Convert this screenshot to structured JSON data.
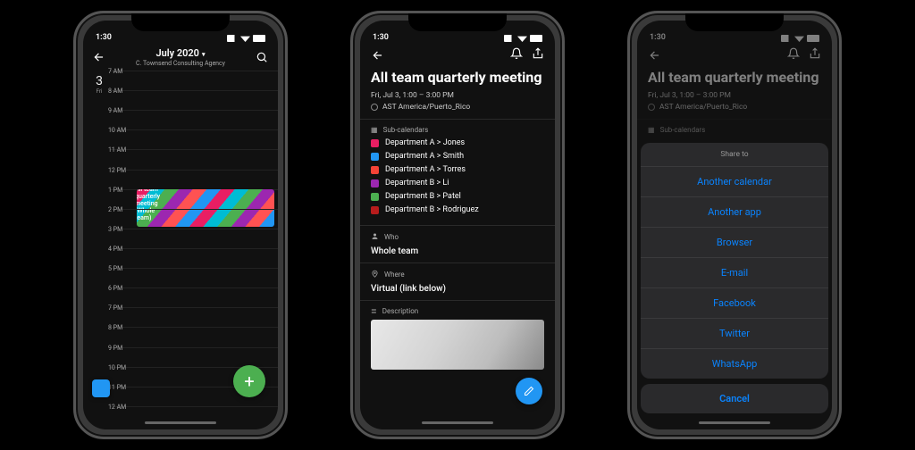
{
  "status_time": "1:30",
  "phone1": {
    "month_title": "July 2020",
    "subtitle": "C. Townsend Consulting Agency",
    "date_num": "3",
    "date_day": "Fri",
    "hours": [
      "7 AM",
      "8 AM",
      "9 AM",
      "10 AM",
      "11 AM",
      "12 PM",
      "1 PM",
      "2 PM",
      "3 PM",
      "4 PM",
      "5 PM",
      "6 PM",
      "7 PM",
      "8 PM",
      "9 PM",
      "10 PM",
      "11 PM",
      "12 AM"
    ],
    "event_label": "All team quarterly meeting (Whole team)"
  },
  "phone2": {
    "title": "All team quarterly meeting",
    "datetime": "Fri, Jul 3, 1:00 – 3:00 PM",
    "timezone": "AST America/Puerto_Rico",
    "section_subcals": "Sub-calendars",
    "subcals": [
      {
        "label": "Department A > Jones",
        "color": "#e91e63"
      },
      {
        "label": "Department A > Smith",
        "color": "#2196f3"
      },
      {
        "label": "Department A > Torres",
        "color": "#f44336"
      },
      {
        "label": "Department B > Li",
        "color": "#9c27b0"
      },
      {
        "label": "Department B > Patel",
        "color": "#4caf50"
      },
      {
        "label": "Department B > Rodriguez",
        "color": "#b71c1c"
      }
    ],
    "section_who": "Who",
    "who": "Whole team",
    "section_where": "Where",
    "where": "Virtual (link below)",
    "section_desc": "Description"
  },
  "phone3": {
    "title": "All team quarterly meeting",
    "datetime": "Fri, Jul 3, 1:00 – 3:00 PM",
    "timezone": "AST America/Puerto_Rico",
    "section_subcals": "Sub-calendars",
    "share_title": "Share to",
    "options": [
      "Another calendar",
      "Another app",
      "Browser",
      "E-mail",
      "Facebook",
      "Twitter",
      "WhatsApp"
    ],
    "cancel": "Cancel"
  }
}
